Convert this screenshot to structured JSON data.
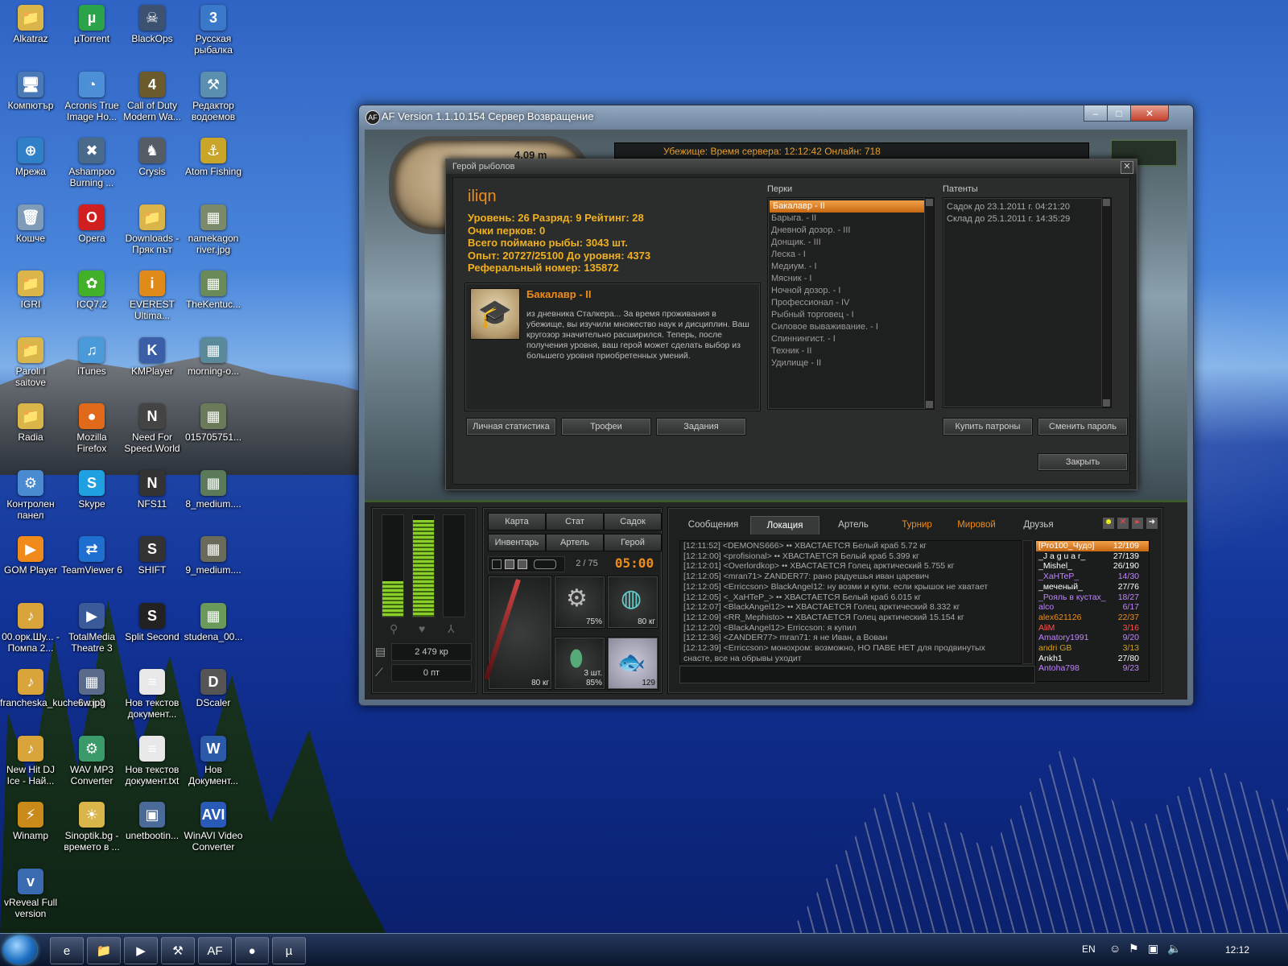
{
  "desktop": {
    "icons": [
      {
        "label": "Alkatraz",
        "glyph": "📁",
        "color": "#d9b54a"
      },
      {
        "label": "µTorrent",
        "glyph": "µ",
        "color": "#2aa34a"
      },
      {
        "label": "BlackOps",
        "glyph": "☠",
        "color": "#3d5270"
      },
      {
        "label": "Русская рыбалка",
        "glyph": "3",
        "color": "#3a78c9"
      },
      {
        "label": "Компютър",
        "glyph": "🖥",
        "color": "#4a79b8"
      },
      {
        "label": "Acronis True Image Ho...",
        "glyph": "◔",
        "color": "#4c8fd6"
      },
      {
        "label": "Call of Duty Modern Wa...",
        "glyph": "4",
        "color": "#6b5a2c"
      },
      {
        "label": "Редактор водоемов",
        "glyph": "⚒",
        "color": "#5a8fb0"
      },
      {
        "label": "Мрежа",
        "glyph": "⊕",
        "color": "#2f7fc9"
      },
      {
        "label": "Ashampoo Burning ...",
        "glyph": "✖",
        "color": "#4a6a8c"
      },
      {
        "label": "Crysis",
        "glyph": "♞",
        "color": "#555c66"
      },
      {
        "label": "Atom Fishing",
        "glyph": "⚓",
        "color": "#c9a52a"
      },
      {
        "label": "Кошче",
        "glyph": "🗑",
        "color": "#7e9bb8"
      },
      {
        "label": "Opera",
        "glyph": "O",
        "color": "#d11f1f"
      },
      {
        "label": "Downloads - Пряк път",
        "glyph": "📁",
        "color": "#d9b54a"
      },
      {
        "label": "namekagon river.jpg",
        "glyph": "▦",
        "color": "#7a8a6a"
      },
      {
        "label": "IGRI",
        "glyph": "📁",
        "color": "#d9b54a"
      },
      {
        "label": "ICQ7.2",
        "glyph": "✿",
        "color": "#43b02a"
      },
      {
        "label": "EVEREST Ultima...",
        "glyph": "i",
        "color": "#e08a1a"
      },
      {
        "label": "TheKentuc...",
        "glyph": "▦",
        "color": "#6a8a5a"
      },
      {
        "label": "Paroli i saitove",
        "glyph": "📁",
        "color": "#d9b54a"
      },
      {
        "label": "iTunes",
        "glyph": "♫",
        "color": "#4a9ad9"
      },
      {
        "label": "KMPlayer",
        "glyph": "K",
        "color": "#3a5ea8"
      },
      {
        "label": "morning-o...",
        "glyph": "▦",
        "color": "#5a8a9a"
      },
      {
        "label": "Radia",
        "glyph": "📁",
        "color": "#d9b54a"
      },
      {
        "label": "Mozilla Firefox",
        "glyph": "●",
        "color": "#e06a1a"
      },
      {
        "label": "Need For Speed.World",
        "glyph": "N",
        "color": "#444"
      },
      {
        "label": "015705751...",
        "glyph": "▦",
        "color": "#6a7a5a"
      },
      {
        "label": "Контролен панел",
        "glyph": "⚙",
        "color": "#4a8ad0"
      },
      {
        "label": "Skype",
        "glyph": "S",
        "color": "#1fa0e0"
      },
      {
        "label": "NFS11",
        "glyph": "N",
        "color": "#333"
      },
      {
        "label": "8_medium....",
        "glyph": "▦",
        "color": "#5a7a5a"
      },
      {
        "label": "GOM Player",
        "glyph": "▶",
        "color": "#f08a1a"
      },
      {
        "label": "TeamViewer 6",
        "glyph": "⇄",
        "color": "#1f6fd0"
      },
      {
        "label": "SHIFT",
        "glyph": "S",
        "color": "#333"
      },
      {
        "label": "9_medium....",
        "glyph": "▦",
        "color": "#6a6a5a"
      },
      {
        "label": "00.орк.Шу... - Помпа 2...",
        "glyph": "♪",
        "color": "#d9a53a"
      },
      {
        "label": "TotalMedia Theatre 3",
        "glyph": "▶",
        "color": "#3a5a9a"
      },
      {
        "label": "Split Second",
        "glyph": "S",
        "color": "#222"
      },
      {
        "label": "studena_00...",
        "glyph": "▦",
        "color": "#6a9a5a"
      },
      {
        "label": "francheska_kuchek.mp3",
        "glyph": "♪",
        "color": "#d9a53a"
      },
      {
        "label": "6w.jpg",
        "glyph": "▦",
        "color": "#5a6a8a"
      },
      {
        "label": "Нов текстов документ...",
        "glyph": "≡",
        "color": "#e8e8e8"
      },
      {
        "label": "DScaler",
        "glyph": "D",
        "color": "#555"
      },
      {
        "label": "New Hit DJ Ice - Най...",
        "glyph": "♪",
        "color": "#d9a53a"
      },
      {
        "label": "WAV MP3 Converter",
        "glyph": "⚙",
        "color": "#3a9a6a"
      },
      {
        "label": "Нов текстов документ.txt",
        "glyph": "≡",
        "color": "#e8e8e8"
      },
      {
        "label": "Нов Документ...",
        "glyph": "W",
        "color": "#2a5aa8"
      },
      {
        "label": "Winamp",
        "glyph": "⚡",
        "color": "#c98a1a"
      },
      {
        "label": "Sinoptik.bg - времето в ...",
        "glyph": "☀",
        "color": "#d9b54a"
      },
      {
        "label": "unetbootin...",
        "glyph": "▣",
        "color": "#4a6a9a"
      },
      {
        "label": "WinAVI Video Converter",
        "glyph": "AVI",
        "color": "#2a5ab8"
      },
      {
        "label": "vReveal Full version",
        "glyph": "v",
        "color": "#3a6ab0"
      }
    ]
  },
  "window": {
    "title": "AF Version 1.1.10.154 Сервер Возвращение",
    "logo": "AF",
    "minimize": "–",
    "maximize": "□",
    "close": "✕"
  },
  "game": {
    "depth": "4.09 m",
    "server_bar": "Убежище:     Время сервера: 12:12:42 Онлайн: 718"
  },
  "hero": {
    "dialog_title": "Герой рыболов",
    "close": "✕",
    "name": "iliqn",
    "stats": [
      "Уровень: 26  Разряд: 9  Рейтинг: 28",
      "Очки перков: 0",
      "Всего поймано рыбы: 3043 шт.",
      "Опыт: 20727/25100 До уровня: 4373",
      "Реферальный номер: 135872"
    ],
    "perk_title": "Бакалавр - II",
    "perk_desc": "из дневника Сталкера... За время проживания в убежище, вы изучили множество наук и дисциплин. Ваш кругозор значительно расширился. Теперь, после получения уровня, ваш герой может сделать выбор из большего уровня приобретенных умений.",
    "perks_label": "Перки",
    "perks": [
      "Бакалавр - II",
      "Барыга. - II",
      "Дневной дозор. - III",
      "Донщик. - III",
      "Леска - I",
      "Медиум. - I",
      "Мясник - I",
      "Ночной дозор. - I",
      "Профессионал - IV",
      "Рыбный торговец - I",
      "Силовое вываживание. - I",
      "Спиннингист. - I",
      "Техник - II",
      "Удилище - II"
    ],
    "patents_label": "Патенты",
    "patents": [
      "Садок до 23.1.2011 г. 04:21:20",
      "Склад до 25.1.2011 г. 14:35:29"
    ],
    "btn_stats": "Личная статистика",
    "btn_trophies": "Трофеи",
    "btn_tasks": "Задания",
    "btn_buy": "Купить патроны",
    "btn_password": "Сменить пароль",
    "btn_close": "Закрыть"
  },
  "panel": {
    "meters": [
      0.35,
      0.95,
      0.0
    ],
    "money": "2 479 кр",
    "points": "0 пт",
    "nav": [
      "Карта",
      "Стат",
      "Садок",
      "Инвентарь",
      "Артель",
      "Герой"
    ],
    "slot_count": "2 / 75",
    "timer": "05:00",
    "rod_weight": "80 кг",
    "reel_pct": "75%",
    "line_weight": "80 кг",
    "bait_count": "3 шт.",
    "bait_pct": "85%",
    "fish_count": "129"
  },
  "chat": {
    "tabs": [
      {
        "label": "Сообщения",
        "style": "normal"
      },
      {
        "label": "Локация",
        "style": "active"
      },
      {
        "label": "Артель",
        "style": "normal"
      },
      {
        "label": "Турнир",
        "style": "orange"
      },
      {
        "label": "Мировой",
        "style": "orange"
      },
      {
        "label": "Друзья",
        "style": "normal"
      }
    ],
    "messages": [
      "[12:11:52] <DEMONS666> •• ХВАСТАЕТСЯ Белый краб 5.72 кг",
      "[12:12:00] <profisional> •• ХВАСТАЕТСЯ Белый краб 5.399 кг",
      "[12:12:01] <Overlordkop> •• ХВАСТАЕТСЯ Голец арктический 5.755 кг",
      "[12:12:05] <mran71> ZANDER77: рано радуешья иван царевич",
      "[12:12:05] <Erriccson> BlackAngel12: ну возми и купи. если крышок не хватает",
      "[12:12:05] <_XaHTeP_> •• ХВАСТАЕТСЯ Белый краб 6.015 кг",
      "[12:12:07] <BlackAngel12> •• ХВАСТАЕТСЯ Голец арктический 8.332 кг",
      "[12:12:09] <RR_Mephisto> •• ХВАСТАЕТСЯ Голец арктический 15.154 кг",
      "[12:12:20] <BlackAngel12> Erriccson: я купил",
      "[12:12:36] <ZANDER77> mran71: я не Иван, а Вован",
      "[12:12:39] <Erriccson> монохром: возможно, НО ПАВЕ НЕТ для продвинутых",
      "снасте, все на обрывы уходит"
    ],
    "users": [
      {
        "name": "[Pro100_Чудо]",
        "score": "12/109",
        "color": "#ffffff",
        "selected": true
      },
      {
        "name": "_J a g u a r_",
        "score": "27/139",
        "color": "#ffffff",
        "selected": false
      },
      {
        "name": "_Mishel_",
        "score": "26/190",
        "color": "#ffffff",
        "selected": false
      },
      {
        "name": "_XaHTeP_",
        "score": "14/30",
        "color": "#c083ff",
        "selected": false
      },
      {
        "name": "_меченый_",
        "score": "27/76",
        "color": "#ffffff",
        "selected": false
      },
      {
        "name": "_Рояль в кустах_",
        "score": "18/27",
        "color": "#c083ff",
        "selected": false
      },
      {
        "name": "alco",
        "score": "6/17",
        "color": "#c083ff",
        "selected": false
      },
      {
        "name": "alex621126",
        "score": "22/37",
        "color": "#f08c1a",
        "selected": false
      },
      {
        "name": "AliM",
        "score": "3/16",
        "color": "#ff5050",
        "selected": false
      },
      {
        "name": "Amatory1991",
        "score": "9/20",
        "color": "#c083ff",
        "selected": false
      },
      {
        "name": "andri GB",
        "score": "3/13",
        "color": "#d0a020",
        "selected": false
      },
      {
        "name": "Ankh1",
        "score": "27/80",
        "color": "#ffffff",
        "selected": false
      },
      {
        "name": "Antoha798",
        "score": "9/23",
        "color": "#c083ff",
        "selected": false
      }
    ]
  },
  "taskbar": {
    "items": [
      "e",
      "📁",
      "▶",
      "⚒",
      "AF",
      "●",
      "µ"
    ],
    "lang": "EN",
    "clock": "12:12"
  }
}
